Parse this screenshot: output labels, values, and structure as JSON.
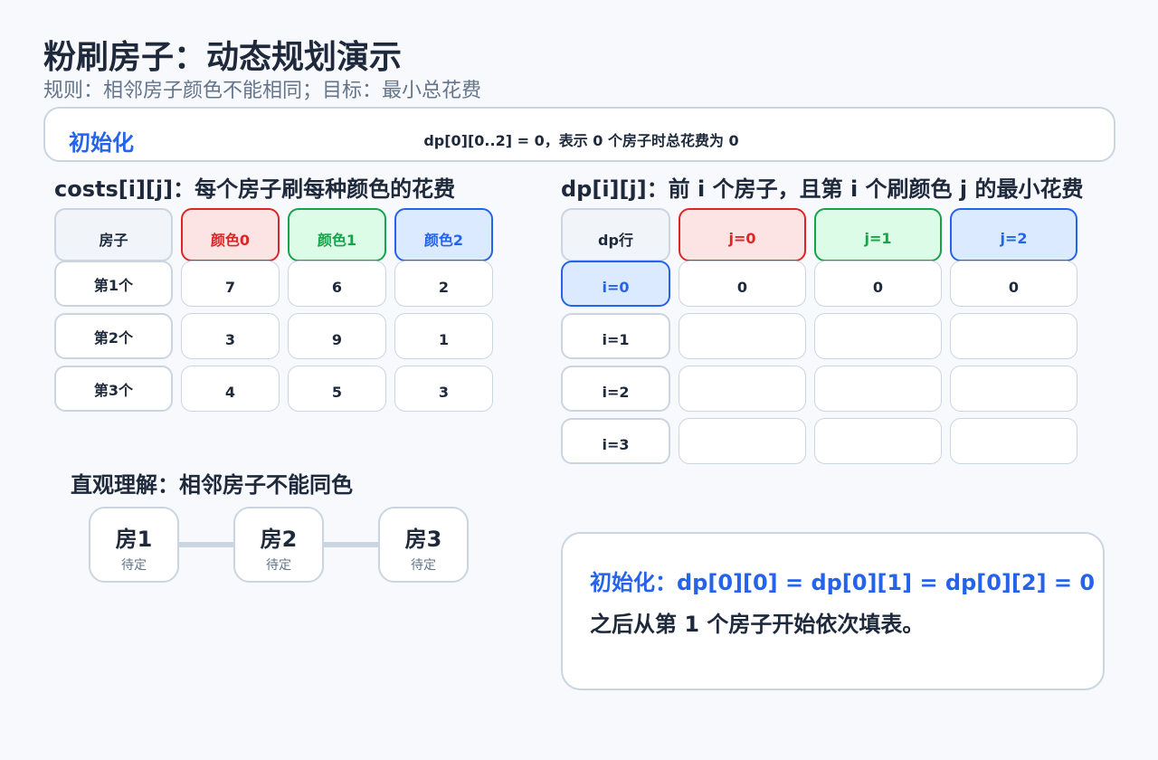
{
  "header": {
    "title": "粉刷房子：动态规划演示",
    "subtitle": "规则：相邻房子颜色不能相同；目标：最小总花费"
  },
  "step": {
    "name": "初始化",
    "description": "dp[0][0..2] = 0，表示 0 个房子时总花费为 0"
  },
  "costs": {
    "title": "costs[i][j]：每个房子刷每种颜色的花费",
    "corner": "房子",
    "columns": [
      "颜色0",
      "颜色1",
      "颜色2"
    ],
    "rows": [
      {
        "label": "第1个",
        "values": [
          "7",
          "6",
          "2"
        ]
      },
      {
        "label": "第2个",
        "values": [
          "3",
          "9",
          "1"
        ]
      },
      {
        "label": "第3个",
        "values": [
          "4",
          "5",
          "3"
        ]
      }
    ]
  },
  "dp": {
    "title": "dp[i][j]：前 i 个房子，且第 i 个刷颜色 j 的最小花费",
    "corner": "dp行",
    "columns": [
      "j=0",
      "j=1",
      "j=2"
    ],
    "rows": [
      {
        "label": "i=0",
        "values": [
          "0",
          "0",
          "0"
        ],
        "active": true
      },
      {
        "label": "i=1",
        "values": [
          "",
          "",
          ""
        ]
      },
      {
        "label": "i=2",
        "values": [
          "",
          "",
          ""
        ]
      },
      {
        "label": "i=3",
        "values": [
          "",
          "",
          ""
        ]
      }
    ]
  },
  "intuition": {
    "title": "直观理解：相邻房子不能同色",
    "houses": [
      {
        "name": "房1",
        "status": "待定"
      },
      {
        "name": "房2",
        "status": "待定"
      },
      {
        "name": "房3",
        "status": "待定"
      }
    ]
  },
  "explain": {
    "line1": "初始化：dp[0][0] = dp[0][1] = dp[0][2] = 0",
    "line2": "之后从第 1 个房子开始依次填表。"
  },
  "colors": {
    "accent": "#2563eb",
    "red": "#dc2626",
    "green": "#16a34a",
    "border": "#cbd5e1",
    "text": "#1e293b",
    "muted": "#64748b"
  }
}
